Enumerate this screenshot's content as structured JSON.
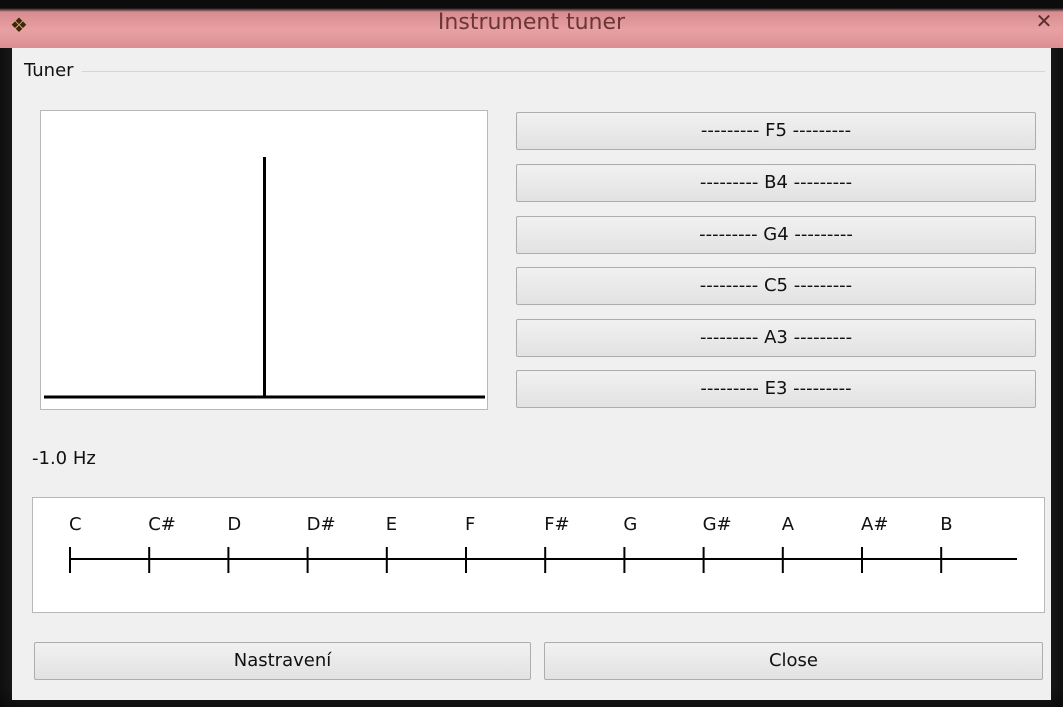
{
  "window": {
    "title": "Instrument tuner",
    "close_glyph": "✕",
    "icon": "app-icon"
  },
  "tuner_group": {
    "label": "Tuner"
  },
  "frequency_plot": {
    "peak_position_fraction": 0.5
  },
  "note_buttons": [
    {
      "label": "--------- F5 ---------"
    },
    {
      "label": "--------- B4 ---------"
    },
    {
      "label": "--------- G4 ---------"
    },
    {
      "label": "--------- C5 ---------"
    },
    {
      "label": "--------- A3 ---------"
    },
    {
      "label": "--------- E3 ---------"
    }
  ],
  "deviation": {
    "text": "-1.0 Hz"
  },
  "note_scale": {
    "notes": [
      "C",
      "C#",
      "D",
      "D#",
      "E",
      "F",
      "F#",
      "G",
      "G#",
      "A",
      "A#",
      "B"
    ]
  },
  "buttons": {
    "settings_label": "Nastravení",
    "close_label": "Close"
  }
}
